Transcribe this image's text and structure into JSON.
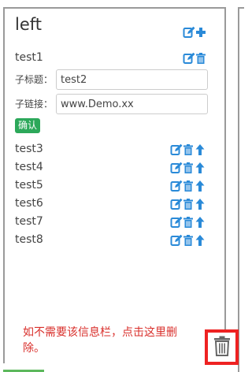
{
  "panel": {
    "title": "left"
  },
  "items_top": [
    {
      "label": "test1"
    }
  ],
  "form": {
    "subtitle_label": "子标题：",
    "subtitle_value": "test2",
    "link_label": "子链接：",
    "link_value": "www.Demo.xx",
    "confirm_label": "确认"
  },
  "items": [
    {
      "label": "test3"
    },
    {
      "label": "test4"
    },
    {
      "label": "test5"
    },
    {
      "label": "test6"
    },
    {
      "label": "test7"
    },
    {
      "label": "test8"
    }
  ],
  "hint": {
    "text": "如不需要该信息栏，点击这里删除。"
  },
  "icons": {
    "header": [
      "edit-icon",
      "plus-icon"
    ],
    "first_item": [
      "edit-icon",
      "trash-icon"
    ],
    "item": [
      "edit-icon",
      "trash-icon",
      "arrow-up-icon"
    ],
    "delete_panel": "trash-icon"
  },
  "colors": {
    "icon_blue": "#2a8ad8",
    "confirm_green": "#2ca85a",
    "hint_red": "#d9302c",
    "highlight_red": "#ee2222"
  }
}
